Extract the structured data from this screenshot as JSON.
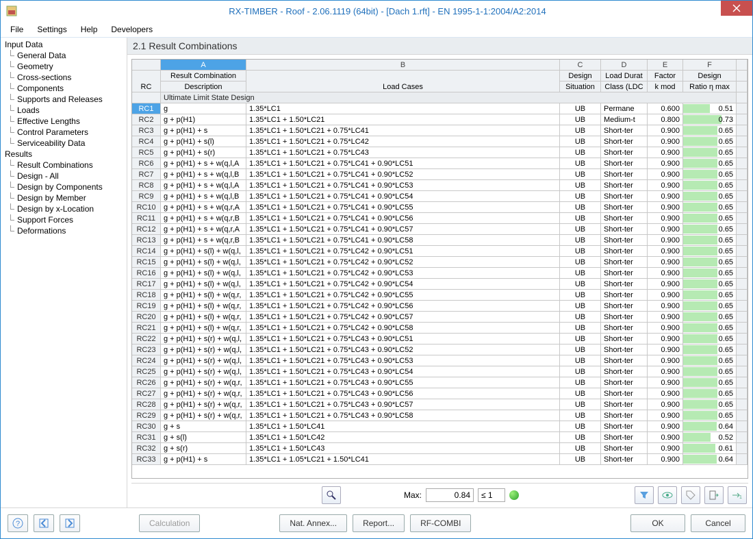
{
  "title": "RX-TIMBER - Roof - 2.06.1119 (64bit) - [Dach 1.rft] - EN 1995-1-1:2004/A2:2014",
  "menu": [
    "File",
    "Settings",
    "Help",
    "Developers"
  ],
  "tree": {
    "input_label": "Input Data",
    "input": [
      "General Data",
      "Geometry",
      "Cross-sections",
      "Components",
      "Supports and Releases",
      "Loads",
      "Effective Lengths",
      "Control Parameters",
      "Serviceability Data"
    ],
    "results_label": "Results",
    "results": [
      "Result Combinations",
      "Design - All",
      "Design by Components",
      "Design by Member",
      "Design by x-Location",
      "Support Forces",
      "Deformations"
    ]
  },
  "pane_title": "2.1 Result Combinations",
  "letters": {
    "A": "A",
    "B": "B",
    "C": "C",
    "D": "D",
    "E": "E",
    "F": "F"
  },
  "hdr": {
    "rc": "RC",
    "a1": "Result Combination",
    "a2": "Description",
    "b": "Load Cases",
    "c1": "Design",
    "c2": "Situation",
    "d1": "Load Durat",
    "d2": "Class (LDC",
    "e1": "Factor",
    "e2": "k mod",
    "f1": "Design",
    "f2": "Ratio η max"
  },
  "group": "Ultimate Limit State Design",
  "rows": [
    {
      "rc": "RC1",
      "a": "g",
      "b": "1.35*LC1",
      "c": "UB",
      "d": "Permane",
      "e": "0.600",
      "f": "0.51",
      "p": 51
    },
    {
      "rc": "RC2",
      "a": "g + p(H1)",
      "b": "1.35*LC1 + 1.50*LC21",
      "c": "UB",
      "d": "Medium-t",
      "e": "0.800",
      "f": "0.73",
      "p": 73
    },
    {
      "rc": "RC3",
      "a": "g + p(H1) + s",
      "b": "1.35*LC1 + 1.50*LC21 + 0.75*LC41",
      "c": "UB",
      "d": "Short-ter",
      "e": "0.900",
      "f": "0.65",
      "p": 65
    },
    {
      "rc": "RC4",
      "a": "g + p(H1) + s(l)",
      "b": "1.35*LC1 + 1.50*LC21 + 0.75*LC42",
      "c": "UB",
      "d": "Short-ter",
      "e": "0.900",
      "f": "0.65",
      "p": 65
    },
    {
      "rc": "RC5",
      "a": "g + p(H1) + s(r)",
      "b": "1.35*LC1 + 1.50*LC21 + 0.75*LC43",
      "c": "UB",
      "d": "Short-ter",
      "e": "0.900",
      "f": "0.65",
      "p": 65
    },
    {
      "rc": "RC6",
      "a": "g + p(H1) + s + w(q,l,A",
      "b": "1.35*LC1 + 1.50*LC21 + 0.75*LC41 + 0.90*LC51",
      "c": "UB",
      "d": "Short-ter",
      "e": "0.900",
      "f": "0.65",
      "p": 65
    },
    {
      "rc": "RC7",
      "a": "g + p(H1) + s + w(q,l,B",
      "b": "1.35*LC1 + 1.50*LC21 + 0.75*LC41 + 0.90*LC52",
      "c": "UB",
      "d": "Short-ter",
      "e": "0.900",
      "f": "0.65",
      "p": 65
    },
    {
      "rc": "RC8",
      "a": "g + p(H1) + s + w(q,l,A",
      "b": "1.35*LC1 + 1.50*LC21 + 0.75*LC41 + 0.90*LC53",
      "c": "UB",
      "d": "Short-ter",
      "e": "0.900",
      "f": "0.65",
      "p": 65
    },
    {
      "rc": "RC9",
      "a": "g + p(H1) + s + w(q,l,B",
      "b": "1.35*LC1 + 1.50*LC21 + 0.75*LC41 + 0.90*LC54",
      "c": "UB",
      "d": "Short-ter",
      "e": "0.900",
      "f": "0.65",
      "p": 65
    },
    {
      "rc": "RC10",
      "a": "g + p(H1) + s + w(q,r,A",
      "b": "1.35*LC1 + 1.50*LC21 + 0.75*LC41 + 0.90*LC55",
      "c": "UB",
      "d": "Short-ter",
      "e": "0.900",
      "f": "0.65",
      "p": 65
    },
    {
      "rc": "RC11",
      "a": "g + p(H1) + s + w(q,r,B",
      "b": "1.35*LC1 + 1.50*LC21 + 0.75*LC41 + 0.90*LC56",
      "c": "UB",
      "d": "Short-ter",
      "e": "0.900",
      "f": "0.65",
      "p": 65
    },
    {
      "rc": "RC12",
      "a": "g + p(H1) + s + w(q,r,A",
      "b": "1.35*LC1 + 1.50*LC21 + 0.75*LC41 + 0.90*LC57",
      "c": "UB",
      "d": "Short-ter",
      "e": "0.900",
      "f": "0.65",
      "p": 65
    },
    {
      "rc": "RC13",
      "a": "g + p(H1) + s + w(q,r,B",
      "b": "1.35*LC1 + 1.50*LC21 + 0.75*LC41 + 0.90*LC58",
      "c": "UB",
      "d": "Short-ter",
      "e": "0.900",
      "f": "0.65",
      "p": 65
    },
    {
      "rc": "RC14",
      "a": "g + p(H1) + s(l) + w(q,l,",
      "b": "1.35*LC1 + 1.50*LC21 + 0.75*LC42 + 0.90*LC51",
      "c": "UB",
      "d": "Short-ter",
      "e": "0.900",
      "f": "0.65",
      "p": 65
    },
    {
      "rc": "RC15",
      "a": "g + p(H1) + s(l) + w(q,l,",
      "b": "1.35*LC1 + 1.50*LC21 + 0.75*LC42 + 0.90*LC52",
      "c": "UB",
      "d": "Short-ter",
      "e": "0.900",
      "f": "0.65",
      "p": 65
    },
    {
      "rc": "RC16",
      "a": "g + p(H1) + s(l) + w(q,l,",
      "b": "1.35*LC1 + 1.50*LC21 + 0.75*LC42 + 0.90*LC53",
      "c": "UB",
      "d": "Short-ter",
      "e": "0.900",
      "f": "0.65",
      "p": 65
    },
    {
      "rc": "RC17",
      "a": "g + p(H1) + s(l) + w(q,l,",
      "b": "1.35*LC1 + 1.50*LC21 + 0.75*LC42 + 0.90*LC54",
      "c": "UB",
      "d": "Short-ter",
      "e": "0.900",
      "f": "0.65",
      "p": 65
    },
    {
      "rc": "RC18",
      "a": "g + p(H1) + s(l) + w(q,r,",
      "b": "1.35*LC1 + 1.50*LC21 + 0.75*LC42 + 0.90*LC55",
      "c": "UB",
      "d": "Short-ter",
      "e": "0.900",
      "f": "0.65",
      "p": 65
    },
    {
      "rc": "RC19",
      "a": "g + p(H1) + s(l) + w(q,r,",
      "b": "1.35*LC1 + 1.50*LC21 + 0.75*LC42 + 0.90*LC56",
      "c": "UB",
      "d": "Short-ter",
      "e": "0.900",
      "f": "0.65",
      "p": 65
    },
    {
      "rc": "RC20",
      "a": "g + p(H1) + s(l) + w(q,r,",
      "b": "1.35*LC1 + 1.50*LC21 + 0.75*LC42 + 0.90*LC57",
      "c": "UB",
      "d": "Short-ter",
      "e": "0.900",
      "f": "0.65",
      "p": 65
    },
    {
      "rc": "RC21",
      "a": "g + p(H1) + s(l) + w(q,r,",
      "b": "1.35*LC1 + 1.50*LC21 + 0.75*LC42 + 0.90*LC58",
      "c": "UB",
      "d": "Short-ter",
      "e": "0.900",
      "f": "0.65",
      "p": 65
    },
    {
      "rc": "RC22",
      "a": "g + p(H1) + s(r) + w(q,l,",
      "b": "1.35*LC1 + 1.50*LC21 + 0.75*LC43 + 0.90*LC51",
      "c": "UB",
      "d": "Short-ter",
      "e": "0.900",
      "f": "0.65",
      "p": 65
    },
    {
      "rc": "RC23",
      "a": "g + p(H1) + s(r) + w(q,l,",
      "b": "1.35*LC1 + 1.50*LC21 + 0.75*LC43 + 0.90*LC52",
      "c": "UB",
      "d": "Short-ter",
      "e": "0.900",
      "f": "0.65",
      "p": 65
    },
    {
      "rc": "RC24",
      "a": "g + p(H1) + s(r) + w(q,l,",
      "b": "1.35*LC1 + 1.50*LC21 + 0.75*LC43 + 0.90*LC53",
      "c": "UB",
      "d": "Short-ter",
      "e": "0.900",
      "f": "0.65",
      "p": 65
    },
    {
      "rc": "RC25",
      "a": "g + p(H1) + s(r) + w(q,l,",
      "b": "1.35*LC1 + 1.50*LC21 + 0.75*LC43 + 0.90*LC54",
      "c": "UB",
      "d": "Short-ter",
      "e": "0.900",
      "f": "0.65",
      "p": 65
    },
    {
      "rc": "RC26",
      "a": "g + p(H1) + s(r) + w(q,r,",
      "b": "1.35*LC1 + 1.50*LC21 + 0.75*LC43 + 0.90*LC55",
      "c": "UB",
      "d": "Short-ter",
      "e": "0.900",
      "f": "0.65",
      "p": 65
    },
    {
      "rc": "RC27",
      "a": "g + p(H1) + s(r) + w(q,r,",
      "b": "1.35*LC1 + 1.50*LC21 + 0.75*LC43 + 0.90*LC56",
      "c": "UB",
      "d": "Short-ter",
      "e": "0.900",
      "f": "0.65",
      "p": 65
    },
    {
      "rc": "RC28",
      "a": "g + p(H1) + s(r) + w(q,r,",
      "b": "1.35*LC1 + 1.50*LC21 + 0.75*LC43 + 0.90*LC57",
      "c": "UB",
      "d": "Short-ter",
      "e": "0.900",
      "f": "0.65",
      "p": 65
    },
    {
      "rc": "RC29",
      "a": "g + p(H1) + s(r) + w(q,r,",
      "b": "1.35*LC1 + 1.50*LC21 + 0.75*LC43 + 0.90*LC58",
      "c": "UB",
      "d": "Short-ter",
      "e": "0.900",
      "f": "0.65",
      "p": 65
    },
    {
      "rc": "RC30",
      "a": "g + s",
      "b": "1.35*LC1 + 1.50*LC41",
      "c": "UB",
      "d": "Short-ter",
      "e": "0.900",
      "f": "0.64",
      "p": 64
    },
    {
      "rc": "RC31",
      "a": "g + s(l)",
      "b": "1.35*LC1 + 1.50*LC42",
      "c": "UB",
      "d": "Short-ter",
      "e": "0.900",
      "f": "0.52",
      "p": 52
    },
    {
      "rc": "RC32",
      "a": "g + s(r)",
      "b": "1.35*LC1 + 1.50*LC43",
      "c": "UB",
      "d": "Short-ter",
      "e": "0.900",
      "f": "0.61",
      "p": 61
    },
    {
      "rc": "RC33",
      "a": "g + p(H1) + s",
      "b": "1.35*LC1 + 1.05*LC21 + 1.50*LC41",
      "c": "UB",
      "d": "Short-ter",
      "e": "0.900",
      "f": "0.64",
      "p": 64
    }
  ],
  "status": {
    "max_label": "Max:",
    "max_val": "0.84",
    "cond": "≤ 1"
  },
  "buttons": {
    "calc": "Calculation",
    "annex": "Nat. Annex...",
    "report": "Report...",
    "combi": "RF-COMBI",
    "ok": "OK",
    "cancel": "Cancel"
  }
}
